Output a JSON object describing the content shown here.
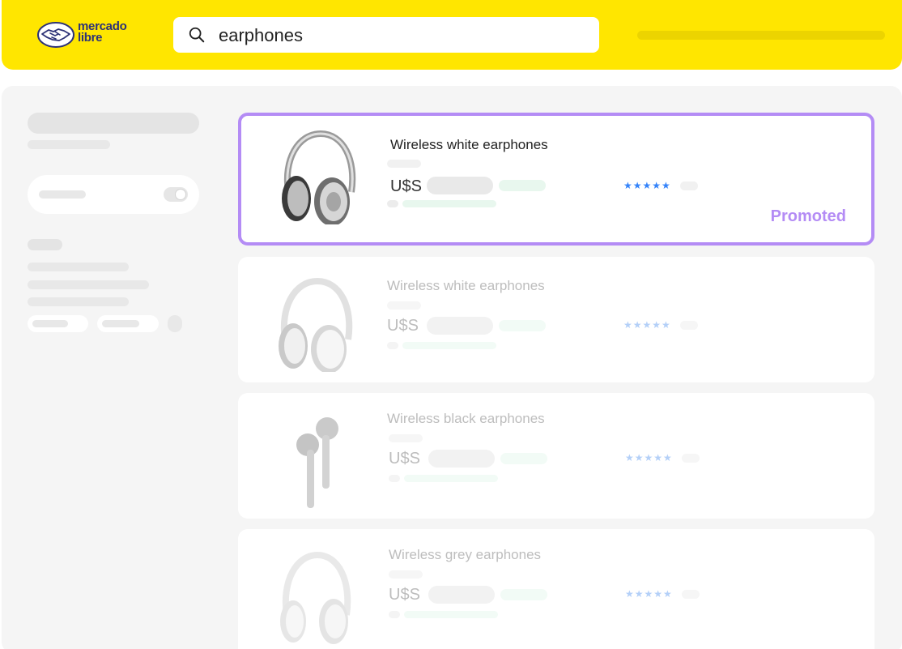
{
  "header": {
    "logo_line1": "mercado",
    "logo_line2": "libre",
    "search_value": "earphones"
  },
  "products": [
    {
      "title": "Wireless white earphones",
      "currency": "U$S",
      "rating": "★★★★★",
      "badge": "Promoted"
    },
    {
      "title": "Wireless white earphones",
      "currency": "U$S",
      "rating": "★★★★★"
    },
    {
      "title": "Wireless black earphones",
      "currency": "U$S",
      "rating": "★★★★★"
    },
    {
      "title": "Wireless grey earphones",
      "currency": "U$S",
      "rating": "★★★★★"
    }
  ],
  "colors": {
    "header_yellow": "#ffe600",
    "logo_navy": "#2d3277",
    "promoted_purple": "#b48cf5",
    "star_blue": "#3483fa",
    "price_green": "#e8f7ee"
  }
}
